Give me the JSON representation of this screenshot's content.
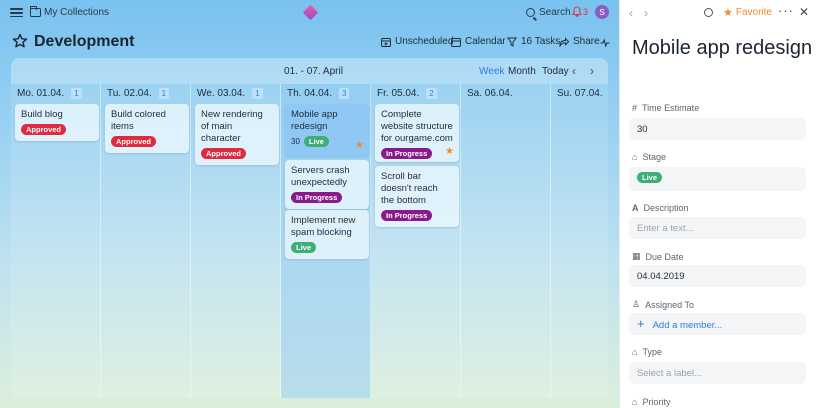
{
  "topbar": {
    "collections": "My Collections",
    "search": "Search",
    "notifications": "3",
    "avatar": "S"
  },
  "header": {
    "title": "Development",
    "actions": {
      "unscheduled": "Unscheduled",
      "calendar": "Calendar",
      "tasks": "16 Tasks",
      "share": "Share"
    }
  },
  "board": {
    "range": "01. - 07. April",
    "views": {
      "week": "Week",
      "month": "Month",
      "today": "Today"
    },
    "days": [
      {
        "label": "Mo. 01.04.",
        "count": "1"
      },
      {
        "label": "Tu. 02.04.",
        "count": "1"
      },
      {
        "label": "We. 03.04.",
        "count": "1"
      },
      {
        "label": "Th. 04.04.",
        "count": "3"
      },
      {
        "label": "Fr. 05.04.",
        "count": "2"
      },
      {
        "label": "Sa. 06.04.",
        "count": ""
      },
      {
        "label": "Su. 07.04.",
        "count": ""
      }
    ],
    "cards": {
      "c1": {
        "title": "Build blog",
        "badge": "Approved"
      },
      "c2": {
        "title": "Build colored items",
        "badge": "Approved"
      },
      "c3": {
        "title": "New rendering of main character",
        "badge": "Approved"
      },
      "c4": {
        "title": "Mobile app redesign",
        "num": "30",
        "badge": "Live"
      },
      "c5": {
        "title": "Servers crash unexpectedly",
        "badge": "In Progress"
      },
      "c6": {
        "title": "Implement new spam blocking",
        "badge": "Live"
      },
      "c7": {
        "title": "Complete website structure for ourgame.com",
        "badge": "In Progress"
      },
      "c8": {
        "title": "Scroll bar doesn't reach the bottom",
        "badge": "In Progress"
      }
    }
  },
  "panel": {
    "favorite": "Favorite",
    "title": "Mobile app redesign",
    "time_label": "Time Estimate",
    "time_value": "30",
    "stage_label": "Stage",
    "stage_value": "Live",
    "desc_label": "Description",
    "desc_placeholder": "Enter a text...",
    "due_label": "Due Date",
    "due_value": "04.04.2019",
    "assigned_label": "Assigned To",
    "assigned_action": "Add a member...",
    "type_label": "Type",
    "type_placeholder": "Select a label...",
    "priority_label": "Priority"
  }
}
